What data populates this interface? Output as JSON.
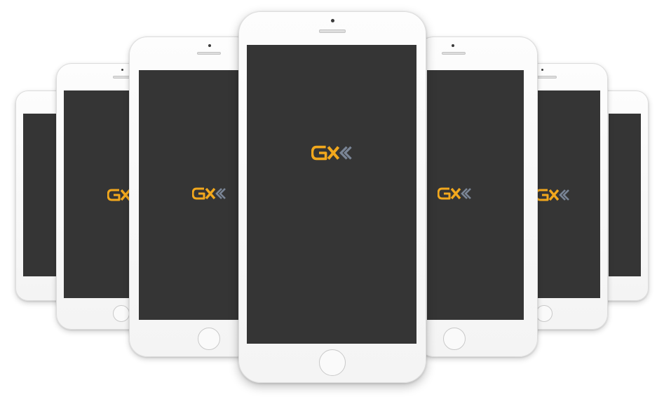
{
  "scene": {
    "description_type": "app-splash-mockup",
    "phone_count": 7,
    "colors": {
      "screen": "#353535",
      "phone_body": "#f6f6f6",
      "logo_primary": "#f2a81d",
      "logo_secondary": "#7a8596"
    },
    "logo": {
      "name": "gex-logo"
    }
  }
}
